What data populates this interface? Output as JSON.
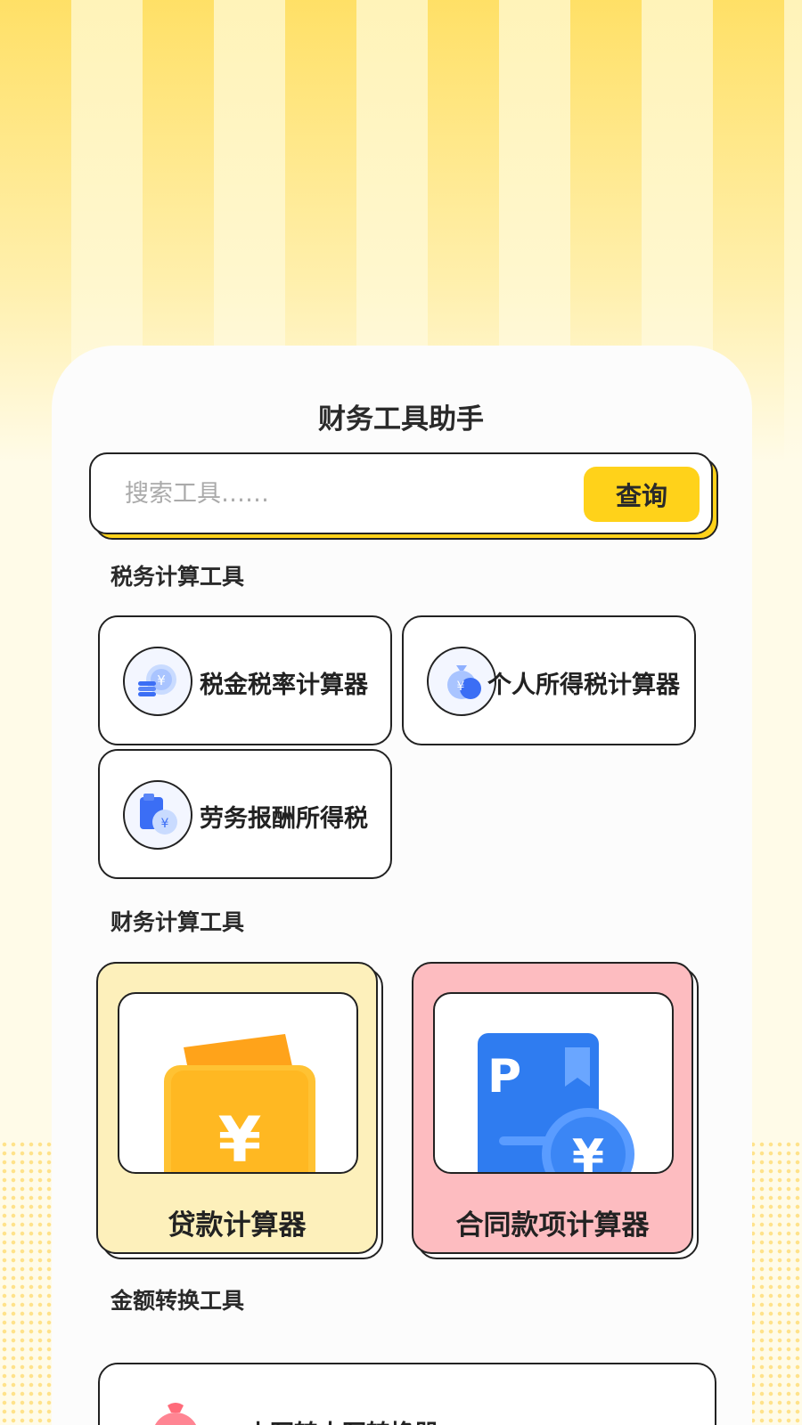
{
  "app": {
    "title": "财务工具助手"
  },
  "search": {
    "placeholder": "搜索工具……",
    "button_label": "查询"
  },
  "sections": {
    "tax": {
      "label": "税务计算工具",
      "items": [
        {
          "label": "税金税率计算器",
          "icon": "coins-icon"
        },
        {
          "label": "个人所得税计算器",
          "icon": "money-bag-icon"
        },
        {
          "label": "劳务报酬所得税",
          "icon": "document-yen-icon"
        }
      ]
    },
    "finance": {
      "label": "财务计算工具",
      "items": [
        {
          "label": "贷款计算器",
          "icon": "wallet-yen-icon",
          "color": "#fdf0bb"
        },
        {
          "label": "合同款项计算器",
          "icon": "contract-yen-icon",
          "color": "#fdbcc0"
        }
      ]
    },
    "conversion": {
      "label": "金额转换工具",
      "items": [
        {
          "label": "小写转大写转换器",
          "icon": "red-money-bag-icon"
        }
      ]
    }
  },
  "colors": {
    "accent": "#ffd21a",
    "icon_blue": "#3b6ef5"
  }
}
